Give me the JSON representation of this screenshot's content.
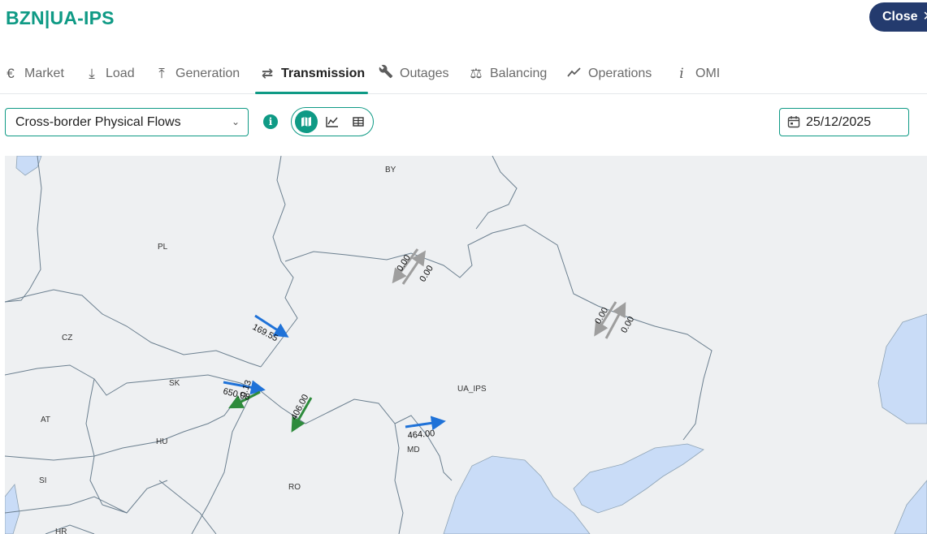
{
  "header": {
    "title": "BZN|UA-IPS",
    "close_label": "Close",
    "close_icon": "close-icon"
  },
  "tabs": [
    {
      "label": "Market",
      "icon": "euro-icon",
      "glyph": "€",
      "active": false
    },
    {
      "label": "Load",
      "icon": "download-icon",
      "glyph": "⤓",
      "active": false
    },
    {
      "label": "Generation",
      "icon": "upload-icon",
      "glyph": "⤒",
      "active": false
    },
    {
      "label": "Transmission",
      "icon": "swap-arrows-icon",
      "glyph": "⇄",
      "active": true
    },
    {
      "label": "Outages",
      "icon": "wrench-icon",
      "glyph": "🔧",
      "active": false
    },
    {
      "label": "Balancing",
      "icon": "scale-icon",
      "glyph": "⚖",
      "active": false
    },
    {
      "label": "Operations",
      "icon": "trend-line-icon",
      "glyph": "↗",
      "active": false
    },
    {
      "label": "OMI",
      "icon": "info-italic-icon",
      "glyph": "i",
      "active": false
    }
  ],
  "toolbar": {
    "dataset_selected": "Cross-border Physical Flows",
    "view_modes": [
      "map",
      "chart",
      "table"
    ],
    "active_view": "map",
    "date_value": "25/12/2025"
  },
  "map": {
    "countries": {
      "by": "BY",
      "pl": "PL",
      "cz": "CZ",
      "sk": "SK",
      "at": "AT",
      "hu": "HU",
      "si": "SI",
      "hr": "HR",
      "ro": "RO",
      "md": "MD",
      "ua": "UA_IPS"
    },
    "flows": {
      "by_a": "0.00",
      "by_b": "0.00",
      "ru_a": "0.00",
      "ru_b": "0.00",
      "pl": "169.55",
      "sk_a": "650.08",
      "sk_b": "0.13",
      "hu": "406.00",
      "md": "464.00"
    },
    "colors": {
      "import": "#1f72d8",
      "export": "#2e8b3c",
      "zero": "#9e9e9e",
      "water": "#c9dcf7",
      "land": "#eef0f2",
      "border": "#6b7f8f"
    }
  }
}
